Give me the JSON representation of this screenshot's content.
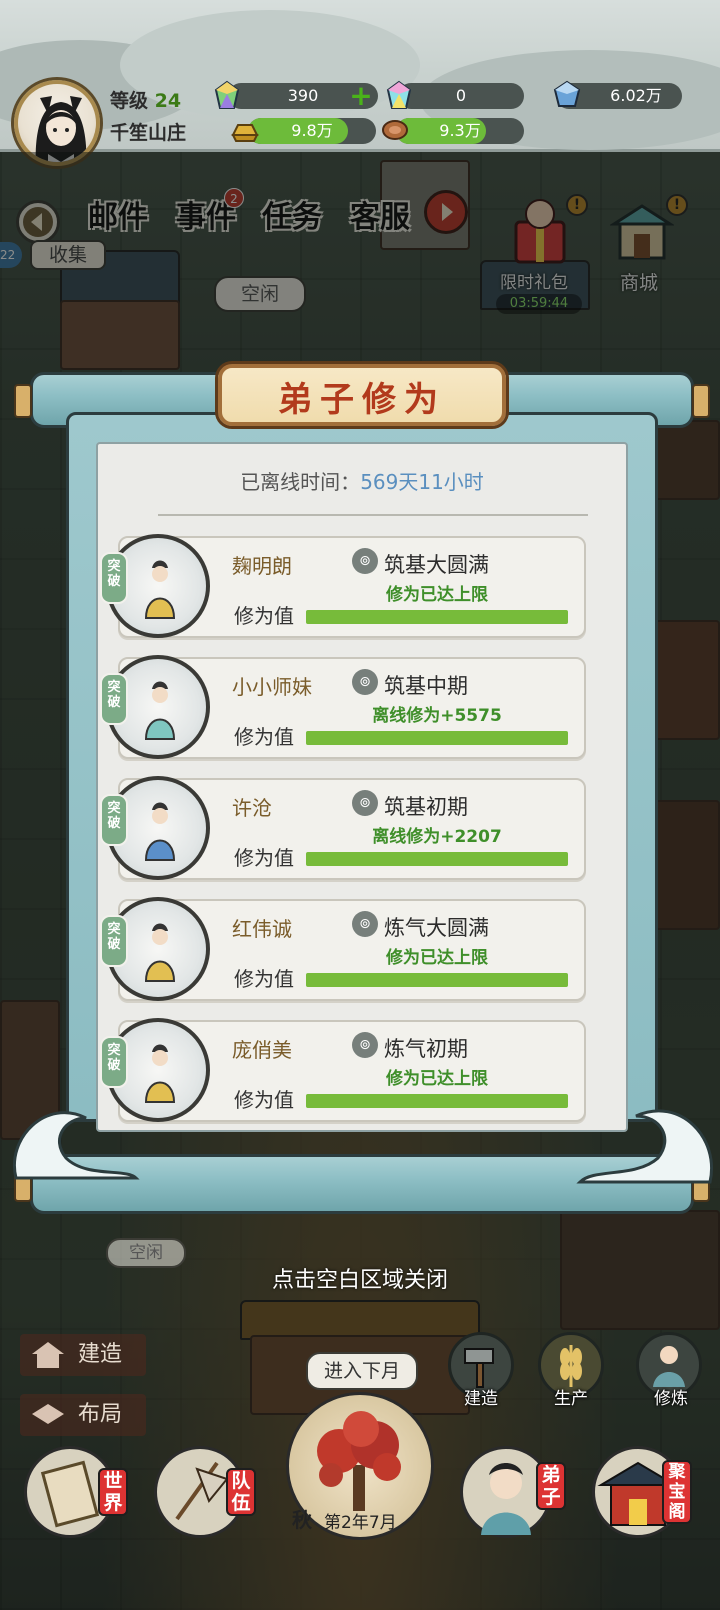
{
  "player": {
    "level_label": "等级",
    "level_value": "24",
    "sect_name": "千笙山庄"
  },
  "resources": [
    {
      "name": "spirit-crystal",
      "value": "390",
      "plus": true
    },
    {
      "name": "rainbow-crystal",
      "value": "0",
      "plus": false
    },
    {
      "name": "blue-gem",
      "value": "6.02万",
      "plus": false
    },
    {
      "name": "gold-ingot",
      "value": "9.8万",
      "plus": false,
      "fill": 0.78
    },
    {
      "name": "meat",
      "value": "9.3万",
      "plus": false,
      "fill": 0.7
    }
  ],
  "top_menu": {
    "items": [
      "邮件",
      "事件",
      "任务",
      "客服"
    ],
    "event_badge": "2",
    "collect_label": "收集",
    "side_badge": "22"
  },
  "right_menu": {
    "gift_label": "限时礼包",
    "gift_timer": "03:59:44",
    "shop_label": "商城"
  },
  "bubbles": {
    "idle_top": "空闲",
    "idle_bottom": "空闲",
    "next_month": "进入下月"
  },
  "dialog": {
    "title": "弟子修为",
    "offline_label": "已离线时间：",
    "offline_value": "569天11小时",
    "cultivation_label": "修为值",
    "breakthrough_label": "突破",
    "disciples": [
      {
        "name": "麹明朗",
        "realm": "筑基大圆满",
        "status": "修为已达上限",
        "progress": 1.0,
        "robe": "gold"
      },
      {
        "name": "小小师妹",
        "realm": "筑基中期",
        "status": "离线修为+5575",
        "progress": 1.0,
        "robe": "teal"
      },
      {
        "name": "许沧",
        "realm": "筑基初期",
        "status": "离线修为+2207",
        "progress": 1.0,
        "robe": "blue"
      },
      {
        "name": "红伟诚",
        "realm": "炼气大圆满",
        "status": "修为已达上限",
        "progress": 1.0,
        "robe": "gold"
      },
      {
        "name": "庞俏美",
        "realm": "炼气初期",
        "status": "修为已达上限",
        "progress": 1.0,
        "robe": "gold"
      }
    ],
    "close_hint": "点击空白区域关闭"
  },
  "bottom": {
    "build_label": "建造",
    "layout_label": "布局",
    "build_icon_label": "建造",
    "produce_label": "生产",
    "cultivate_label": "修炼",
    "nav": [
      {
        "label": "世界"
      },
      {
        "label": "队伍"
      },
      {
        "label": "弟子"
      },
      {
        "label": "聚宝阁"
      }
    ],
    "season": "秋",
    "date": "第2年7月"
  }
}
